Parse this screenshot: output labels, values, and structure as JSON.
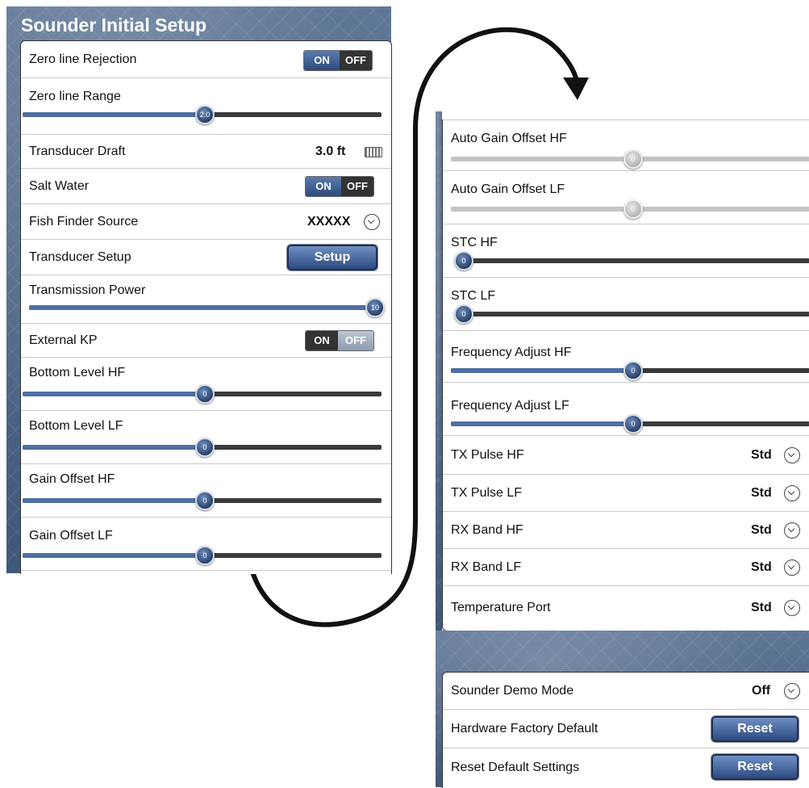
{
  "left": {
    "title": "Sounder Initial Setup",
    "zero_line_rejection": {
      "label": "Zero line Rejection",
      "on": "ON",
      "off": "OFF"
    },
    "zero_line_range": {
      "label": "Zero line Range",
      "value": "2.0"
    },
    "transducer_draft": {
      "label": "Transducer Draft",
      "value": "3.0 ft"
    },
    "salt_water": {
      "label": "Salt Water",
      "on": "ON",
      "off": "OFF"
    },
    "fish_finder_source": {
      "label": "Fish Finder Source",
      "value": "XXXXX"
    },
    "transducer_setup": {
      "label": "Transducer Setup",
      "button": "Setup"
    },
    "transmission_power": {
      "label": "Transmission Power",
      "value": "10"
    },
    "external_kp": {
      "label": "External KP",
      "on": "ON",
      "off": "OFF"
    },
    "bottom_level_hf": {
      "label": "Bottom Level HF",
      "value": "0"
    },
    "bottom_level_lf": {
      "label": "Bottom Level LF",
      "value": "0"
    },
    "gain_offset_hf": {
      "label": "Gain Offset HF",
      "value": "0"
    },
    "gain_offset_lf": {
      "label": "Gain Offset LF",
      "value": "0"
    }
  },
  "right": {
    "auto_gain_offset_hf": {
      "label": "Auto Gain Offset HF",
      "value": "0"
    },
    "auto_gain_offset_lf": {
      "label": "Auto Gain Offset LF",
      "value": "0"
    },
    "stc_hf": {
      "label": "STC HF",
      "value": "0"
    },
    "stc_lf": {
      "label": "STC LF",
      "value": "0"
    },
    "frequency_adjust_hf": {
      "label": "Frequency Adjust HF",
      "value": "0"
    },
    "frequency_adjust_lf": {
      "label": "Frequency Adjust LF",
      "value": "0"
    },
    "tx_pulse_hf": {
      "label": "TX Pulse HF",
      "value": "Std"
    },
    "tx_pulse_lf": {
      "label": "TX Pulse LF",
      "value": "Std"
    },
    "rx_band_hf": {
      "label": "RX Band HF",
      "value": "Std"
    },
    "rx_band_lf": {
      "label": "RX Band LF",
      "value": "Std"
    },
    "temperature_port": {
      "label": "Temperature Port",
      "value": "Std"
    }
  },
  "bottom": {
    "sounder_demo_mode": {
      "label": "Sounder Demo Mode",
      "value": "Off"
    },
    "hardware_factory_default": {
      "label": "Hardware Factory Default",
      "button": "Reset"
    },
    "reset_default_settings": {
      "label": "Reset Default Settings",
      "button": "Reset"
    }
  }
}
